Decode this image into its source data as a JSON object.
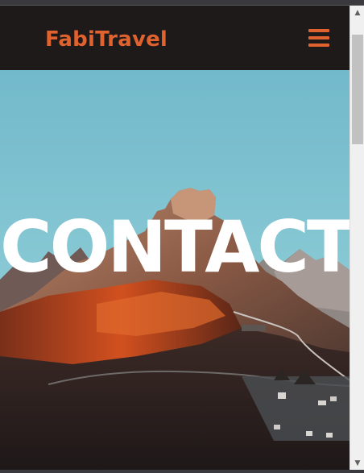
{
  "navbar": {
    "brand": "FabiTravel",
    "menu_icon": "hamburger-menu-icon",
    "brand_color": "#e0622e",
    "background_color": "#1f1a1a"
  },
  "hero": {
    "title": "CONTACT",
    "image": "mountain-landscape-photo",
    "sky_color": "#7cc0d0"
  },
  "scrollbar": {
    "up_arrow": "▲",
    "down_arrow": "▼"
  }
}
